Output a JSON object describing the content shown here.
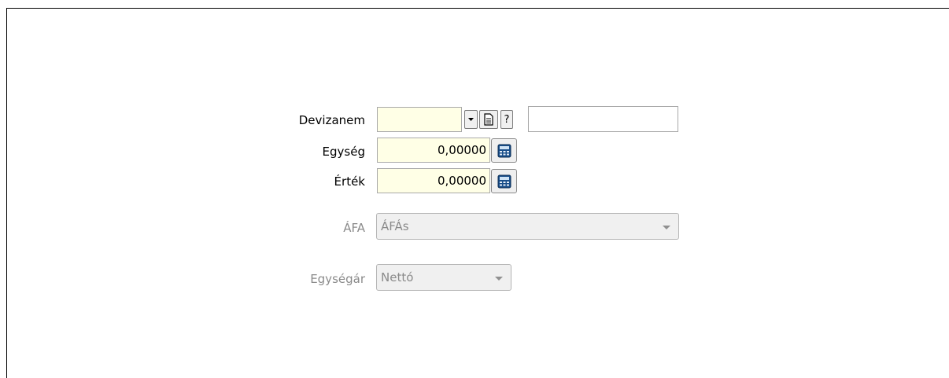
{
  "form": {
    "devizanem": {
      "label": "Devizanem",
      "value": "",
      "secondary_value": "",
      "dropdown_icon": "chevron-down-icon",
      "document_icon": "document-icon",
      "help_label": "?"
    },
    "egyseg": {
      "label": "Egység",
      "value": "0,00000",
      "calculator_icon": "calculator-icon"
    },
    "ertek": {
      "label": "Érték",
      "value": "0,00000",
      "calculator_icon": "calculator-icon"
    },
    "afa": {
      "label": "ÁFA",
      "selected": "ÁFÁs",
      "disabled": true
    },
    "egysegar": {
      "label": "Egységár",
      "selected": "Nettó",
      "disabled": true
    }
  },
  "colors": {
    "input_background": "#ffffe6",
    "disabled_text": "#8a8a8a",
    "disabled_background": "#f0f0f0"
  }
}
